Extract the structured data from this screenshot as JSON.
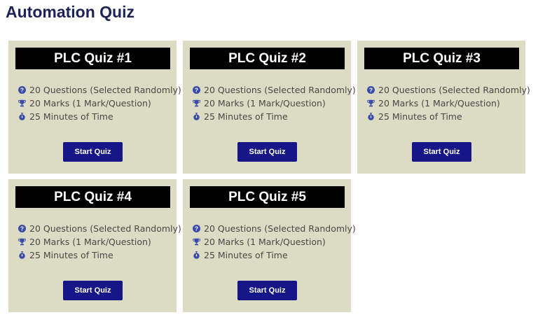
{
  "page": {
    "title": "Automation Quiz"
  },
  "colors": {
    "title": "#1c2357",
    "card_background": "#dcdcc4",
    "card_header": "#000000",
    "icon": "#3a4aa8",
    "button": "#161688"
  },
  "cards": [
    {
      "title": "PLC Quiz #1",
      "info": [
        {
          "icon": "question-circle-icon",
          "text": "20 Questions (Selected Randomly)"
        },
        {
          "icon": "trophy-icon",
          "text": "20 Marks (1 Mark/Question)"
        },
        {
          "icon": "stopwatch-icon",
          "text": "25 Minutes of Time"
        }
      ],
      "button_label": "Start Quiz"
    },
    {
      "title": "PLC Quiz #2",
      "info": [
        {
          "icon": "question-circle-icon",
          "text": "20 Questions (Selected Randomly)"
        },
        {
          "icon": "trophy-icon",
          "text": "20 Marks (1 Mark/Question)"
        },
        {
          "icon": "stopwatch-icon",
          "text": "25 Minutes of Time"
        }
      ],
      "button_label": "Start Quiz"
    },
    {
      "title": "PLC Quiz #3",
      "info": [
        {
          "icon": "question-circle-icon",
          "text": "20 Questions (Selected Randomly)"
        },
        {
          "icon": "trophy-icon",
          "text": "20 Marks (1 Mark/Question)"
        },
        {
          "icon": "stopwatch-icon",
          "text": "25 Minutes of Time"
        }
      ],
      "button_label": "Start Quiz"
    },
    {
      "title": "PLC Quiz #4",
      "info": [
        {
          "icon": "question-circle-icon",
          "text": "20 Questions (Selected Randomly)"
        },
        {
          "icon": "trophy-icon",
          "text": "20 Marks (1 Mark/Question)"
        },
        {
          "icon": "stopwatch-icon",
          "text": "25 Minutes of Time"
        }
      ],
      "button_label": "Start Quiz"
    },
    {
      "title": "PLC Quiz #5",
      "info": [
        {
          "icon": "question-circle-icon",
          "text": "20 Questions (Selected Randomly)"
        },
        {
          "icon": "trophy-icon",
          "text": "20 Marks (1 Mark/Question)"
        },
        {
          "icon": "stopwatch-icon",
          "text": "25 Minutes of Time"
        }
      ],
      "button_label": "Start Quiz"
    }
  ]
}
